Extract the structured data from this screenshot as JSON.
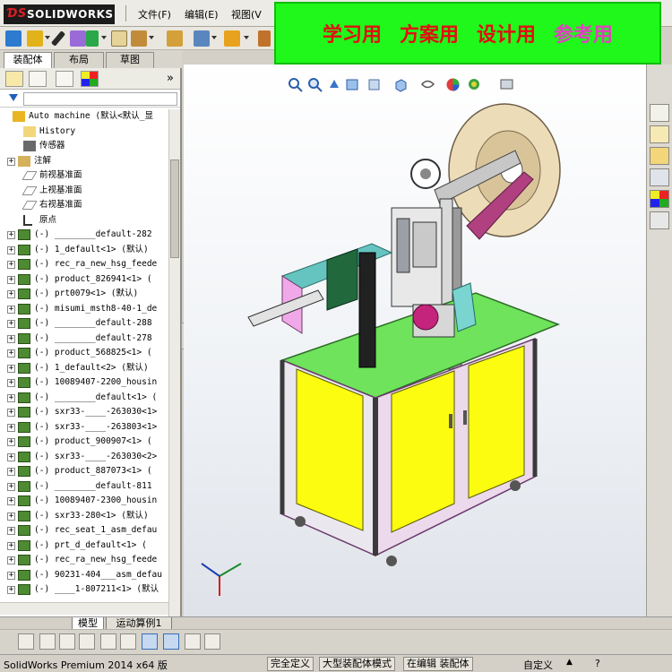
{
  "app": {
    "brand": "SOLIDWORKS"
  },
  "menu": {
    "file": "文件(F)",
    "edit": "编辑(E)",
    "view": "视图(V"
  },
  "banner": {
    "items": [
      {
        "text": "学习用",
        "color": "#e01010"
      },
      {
        "text": "方案用",
        "color": "#e01010"
      },
      {
        "text": "设计用",
        "color": "#e01010"
      },
      {
        "text": "参考用",
        "color": "#e040c0"
      }
    ]
  },
  "panel": {
    "tabs": [
      "装配体",
      "布局",
      "草图"
    ],
    "expand_glyph": "»",
    "tree": [
      {
        "label": "Auto machine  (默认<默认_显",
        "icon": "assembly-icon",
        "expander": ""
      },
      {
        "label": "History",
        "icon": "history-icon",
        "expander": ""
      },
      {
        "label": "传感器",
        "icon": "sensor-icon",
        "expander": ""
      },
      {
        "label": "注解",
        "icon": "annotation-icon",
        "expander": "+"
      },
      {
        "label": "前视基准面",
        "icon": "plane-icon",
        "expander": ""
      },
      {
        "label": "上视基准面",
        "icon": "plane-icon",
        "expander": ""
      },
      {
        "label": "右视基准面",
        "icon": "plane-icon",
        "expander": ""
      },
      {
        "label": "原点",
        "icon": "origin-icon",
        "expander": ""
      },
      {
        "label": "(-) ________default-282",
        "icon": "subassembly-icon",
        "expander": "+"
      },
      {
        "label": "(-) 1_default<1> (默认)",
        "icon": "subassembly-icon",
        "expander": "+"
      },
      {
        "label": "(-) rec_ra_new_hsg_feede",
        "icon": "subassembly-icon",
        "expander": "+"
      },
      {
        "label": "(-) product_826941<1> (",
        "icon": "subassembly-icon",
        "expander": "+"
      },
      {
        "label": "(-) prt0079<1> (默认)",
        "icon": "subassembly-icon",
        "expander": "+"
      },
      {
        "label": "(-) misumi_msth8-40-1_de",
        "icon": "subassembly-icon",
        "expander": "+"
      },
      {
        "label": "(-) ________default-288",
        "icon": "subassembly-icon",
        "expander": "+"
      },
      {
        "label": "(-) ________default-278",
        "icon": "subassembly-icon",
        "expander": "+"
      },
      {
        "label": "(-) product_568825<1> (",
        "icon": "subassembly-icon",
        "expander": "+"
      },
      {
        "label": "(-) 1_default<2> (默认)",
        "icon": "subassembly-icon",
        "expander": "+"
      },
      {
        "label": "(-) 10089407-2200_housin",
        "icon": "subassembly-icon",
        "expander": "+"
      },
      {
        "label": "(-) ________default<1> (",
        "icon": "subassembly-icon",
        "expander": "+"
      },
      {
        "label": "(-) sxr33-____-263030<1>",
        "icon": "subassembly-icon",
        "expander": "+"
      },
      {
        "label": "(-) sxr33-____-263803<1>",
        "icon": "subassembly-icon",
        "expander": "+"
      },
      {
        "label": "(-) product_900907<1> (",
        "icon": "subassembly-icon",
        "expander": "+"
      },
      {
        "label": "(-) sxr33-____-263030<2>",
        "icon": "subassembly-icon",
        "expander": "+"
      },
      {
        "label": "(-) product_887073<1> (",
        "icon": "subassembly-icon",
        "expander": "+"
      },
      {
        "label": "(-) ________default-811",
        "icon": "subassembly-icon",
        "expander": "+"
      },
      {
        "label": "(-) 10089407-2300_housin",
        "icon": "subassembly-icon",
        "expander": "+"
      },
      {
        "label": "(-) sxr33-280<1> (默认)",
        "icon": "subassembly-icon",
        "expander": "+"
      },
      {
        "label": "(-) rec_seat_1_asm_defau",
        "icon": "subassembly-icon",
        "expander": "+"
      },
      {
        "label": "(-) prt_d_default<1> (",
        "icon": "subassembly-icon",
        "expander": "+"
      },
      {
        "label": "(-) rec_ra_new_hsg_feede",
        "icon": "subassembly-icon",
        "expander": "+"
      },
      {
        "label": "(-) 90231-404___asm_defau",
        "icon": "subassembly-icon",
        "expander": "+"
      },
      {
        "label": "(-) ____1-807211<1> (默认",
        "icon": "subassembly-icon",
        "expander": "+"
      }
    ]
  },
  "bottom_tabs": [
    "模型",
    "运动算例1"
  ],
  "status": {
    "product": "SolidWorks Premium 2014 x64 版",
    "cells": [
      "完全定义",
      "大型装配体模式",
      "在编辑 装配体"
    ],
    "custom": "自定义"
  },
  "colors": {
    "banner_bg": "#1ff81a",
    "panel_bg": "#ffffff",
    "chrome": "#d4d0c8"
  }
}
